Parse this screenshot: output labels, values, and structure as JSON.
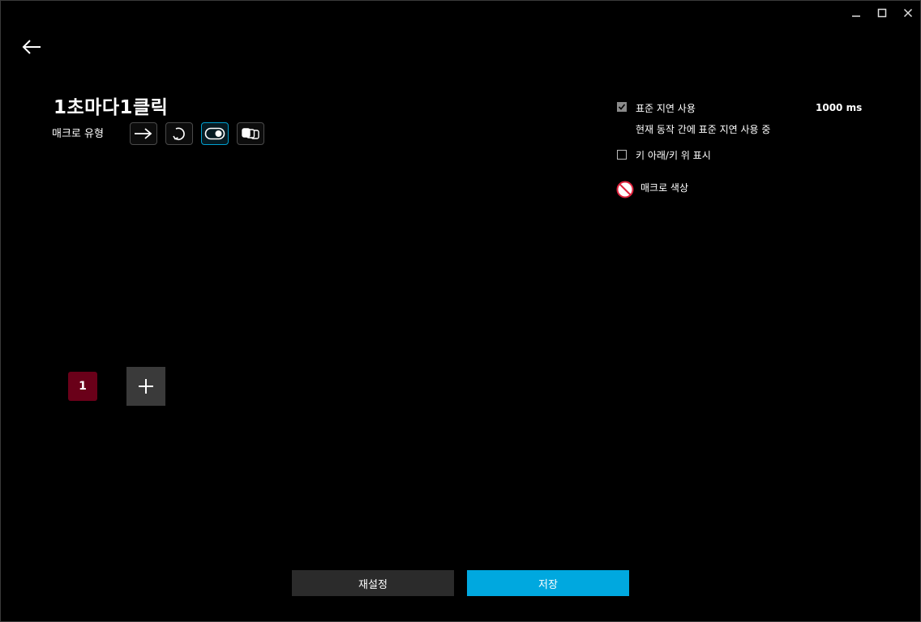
{
  "window": {
    "minimize_icon": "minimize-icon",
    "maximize_icon": "maximize-icon",
    "close_icon": "close-icon"
  },
  "macro": {
    "name": "1초마다1클릭",
    "type_label": "매크로 유형",
    "types": [
      "arrow-right-icon",
      "repeat-icon",
      "toggle-icon",
      "sequence-icon"
    ],
    "selected_type_index": 2
  },
  "options": {
    "standard_delay_label": "표준 지연 사용",
    "standard_delay_checked": true,
    "standard_delay_value": "1000 ms",
    "standard_delay_sub": "현재 동작 간에 표준 지연 사용 중",
    "key_updown_label": "키 아래/키 위 표시",
    "key_updown_checked": false,
    "macro_color_label": "매크로 색상"
  },
  "steps": {
    "first_step": "1"
  },
  "actions": {
    "reset_label": "재설정",
    "save_label": "저장"
  },
  "colors": {
    "accent": "#00a8df",
    "step_badge": "#6a0019",
    "background": "#000000"
  }
}
